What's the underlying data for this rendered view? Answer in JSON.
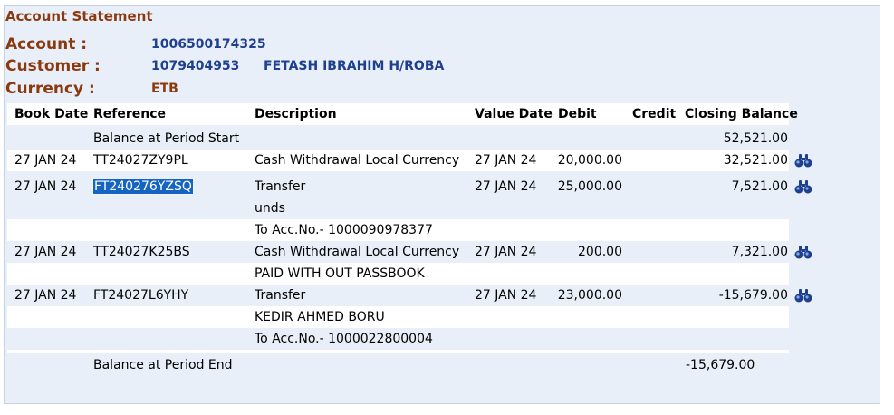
{
  "header": {
    "title": "Account Statement",
    "account_label": "Account :",
    "account_value": "1006500174325",
    "customer_label": "Customer :",
    "customer_id": "1079404953",
    "customer_name": "FETASH IBRAHIM H/ROBA",
    "currency_label": "Currency :",
    "currency_value": "ETB"
  },
  "table": {
    "columns": [
      "Book Date",
      "Reference",
      "Description",
      "Value Date",
      "Debit",
      "Credit",
      "Closing Balance"
    ],
    "opening": {
      "label": "Balance at Period Start",
      "balance": "52,521.00"
    },
    "rows": [
      {
        "book_date": "27 JAN 24",
        "reference": "TT24027ZY9PL",
        "description": [
          "Cash Withdrawal Local Currency"
        ],
        "value_date": "27 JAN 24",
        "debit": "20,000.00",
        "credit": "",
        "balance": "32,521.00"
      },
      {
        "book_date": "27 JAN 24",
        "reference": "FT240276YZSQ",
        "description": [
          "Transfer",
          "unds",
          "To Acc.No.- 1000090978377"
        ],
        "value_date": "27 JAN 24",
        "debit": "25,000.00",
        "credit": "",
        "balance": "7,521.00"
      },
      {
        "book_date": "27 JAN 24",
        "reference": "TT24027K25BS",
        "description": [
          "Cash Withdrawal Local Currency",
          "PAID WITH OUT PASSBOOK"
        ],
        "value_date": "27 JAN 24",
        "debit": "200.00",
        "credit": "",
        "balance": "7,321.00"
      },
      {
        "book_date": "27 JAN 24",
        "reference": "FT24027L6YHY",
        "description": [
          "Transfer",
          "KEDIR AHMED BORU",
          "To Acc.No.- 1000022800004"
        ],
        "value_date": "27 JAN 24",
        "debit": "23,000.00",
        "credit": "",
        "balance": "-15,679.00"
      }
    ],
    "closing": {
      "label": "Balance at Period End",
      "balance": "-15,679.00"
    }
  },
  "icons": {
    "view_detail": "binoculars-icon"
  },
  "colors": {
    "label": "#8b3a0f",
    "value": "#1f3f8f",
    "selection": "#1565c0",
    "panel": "#e8eff8"
  }
}
